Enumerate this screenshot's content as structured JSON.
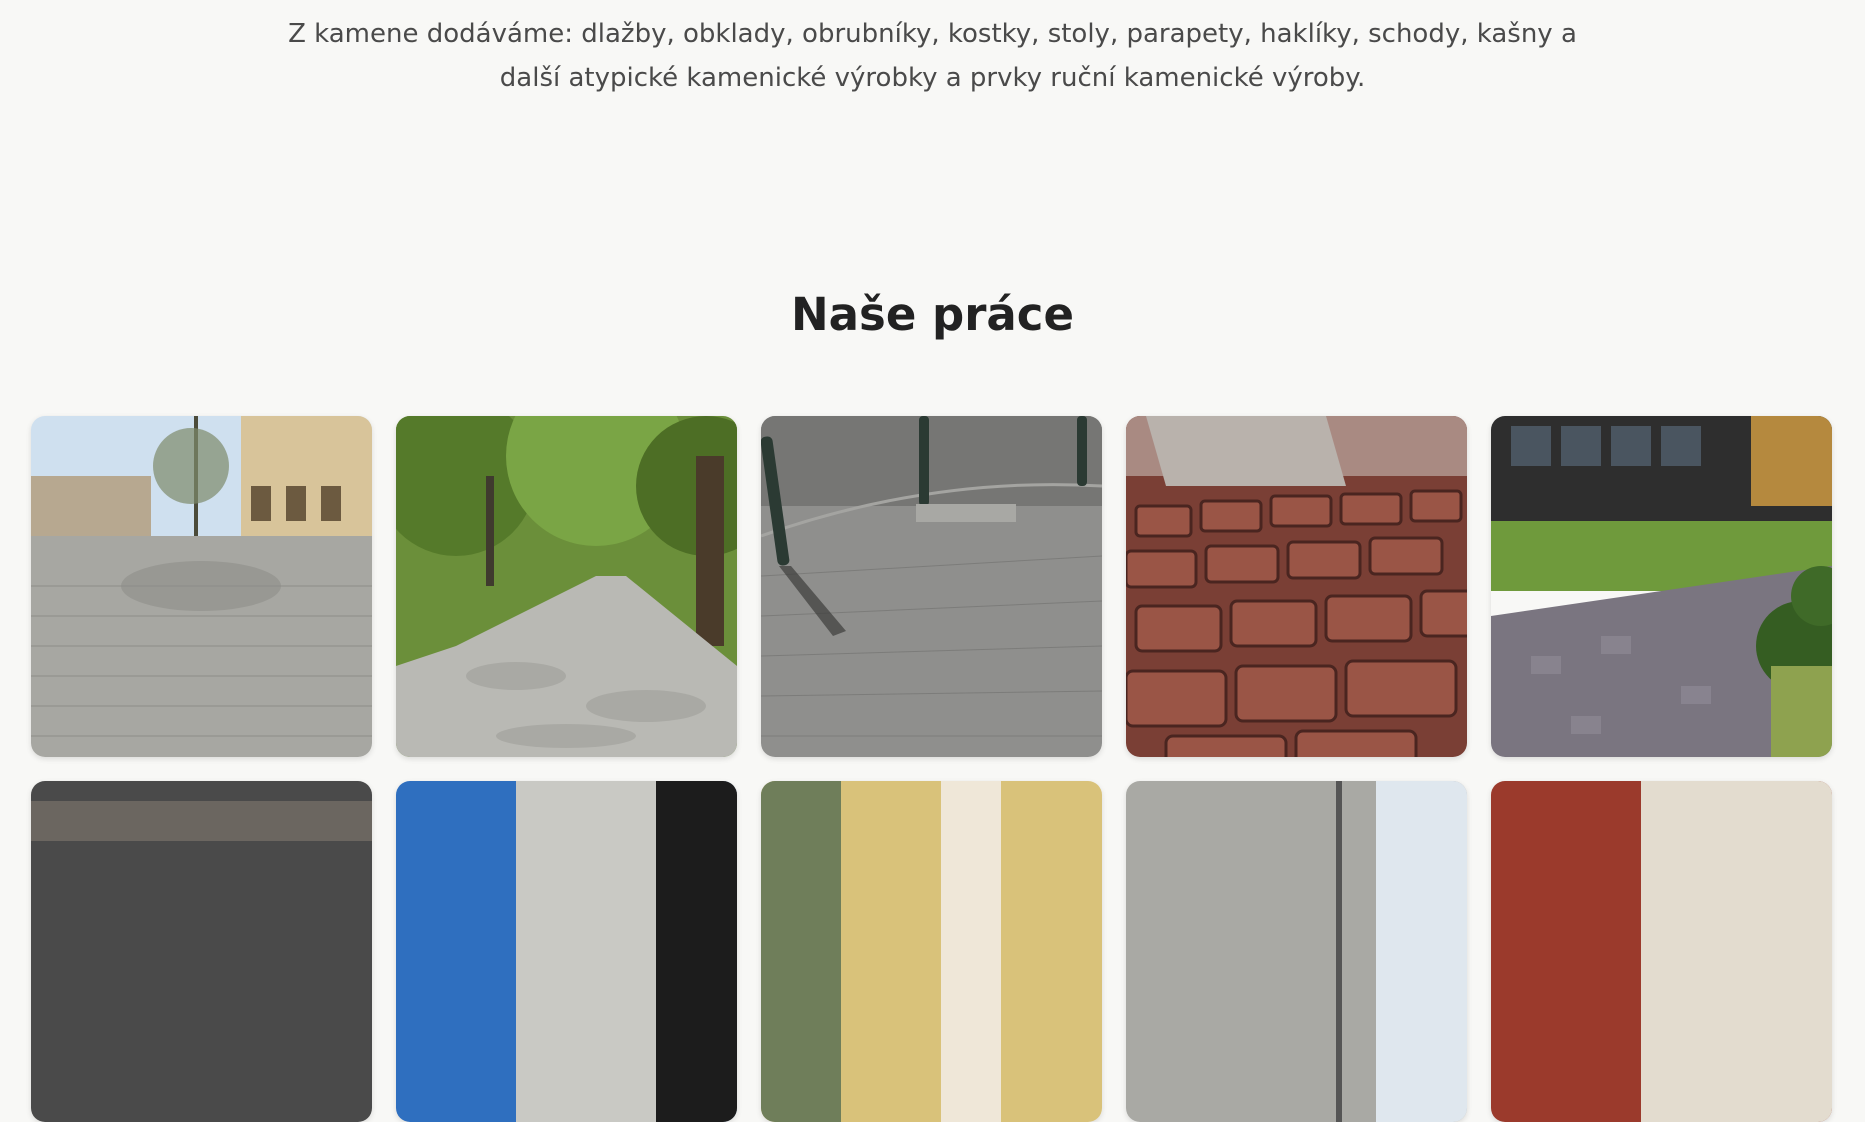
{
  "intro": {
    "line1": "Z kamene dodáváme: dlažby, obklady, obrubníky, kostky, stoly, parapety, haklíky, schody, kašny a",
    "line2": "další atypické kamenické výrobky a prvky ruční kamenické výroby."
  },
  "section": {
    "title": "Naše práce"
  },
  "gallery": {
    "photos": [
      {
        "icon": "town-square-cobblestone-photo"
      },
      {
        "icon": "park-path-cobblestone-photo"
      },
      {
        "icon": "grey-paving-bollards-photo"
      },
      {
        "icon": "red-granite-cobbles-closeup-photo"
      },
      {
        "icon": "modern-building-cobble-path-photo"
      },
      {
        "icon": "street-cafe-photo"
      },
      {
        "icon": "building-facade-blue-sky-photo"
      },
      {
        "icon": "yellow-building-street-photo"
      },
      {
        "icon": "street-lamp-buildings-photo"
      },
      {
        "icon": "red-brick-building-photo"
      }
    ]
  }
}
